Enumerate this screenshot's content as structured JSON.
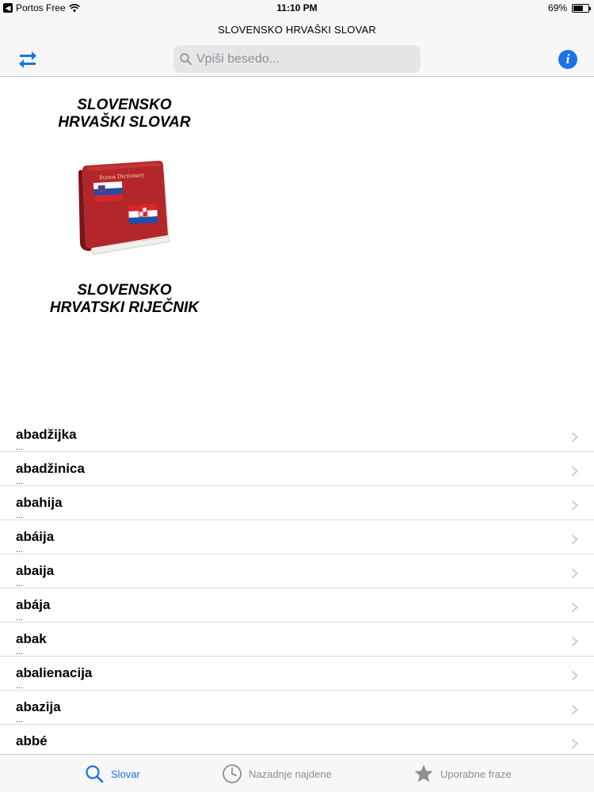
{
  "status": {
    "carrier": "Portos Free",
    "time": "11:10 PM",
    "battery": "69%",
    "battery_level": 0.69
  },
  "nav": {
    "title": "SLOVENSKO HRVAŠKI SLOVAR",
    "search_placeholder": "Vpiši besedo...",
    "info_label": "i"
  },
  "banner": {
    "title_top": "SLOVENSKO\nHRVAŠKI SLOVAR",
    "book_label": "Portos Dictionary",
    "title_bottom": "SLOVENSKO\nHRVATSKI RIJEČNIK"
  },
  "entries": [
    {
      "term": "abadžijka",
      "sub": "..."
    },
    {
      "term": "abadžinica",
      "sub": "..."
    },
    {
      "term": "abahija",
      "sub": "..."
    },
    {
      "term": "abáija",
      "sub": "..."
    },
    {
      "term": "abaija",
      "sub": "..."
    },
    {
      "term": "abája",
      "sub": "..."
    },
    {
      "term": "abak",
      "sub": "..."
    },
    {
      "term": "abalienacija",
      "sub": "..."
    },
    {
      "term": "abazija",
      "sub": "..."
    },
    {
      "term": "abbé",
      "sub": "..."
    }
  ],
  "tabs": [
    {
      "label": "Slovar",
      "icon": "search-icon",
      "active": true
    },
    {
      "label": "Nazadnje najdene",
      "icon": "clock-icon",
      "active": false
    },
    {
      "label": "Uporabne fraze",
      "icon": "star-icon",
      "active": false
    }
  ],
  "colors": {
    "accent": "#1a73e8",
    "book_red": "#b3262a",
    "inactive": "#8e8e93"
  }
}
